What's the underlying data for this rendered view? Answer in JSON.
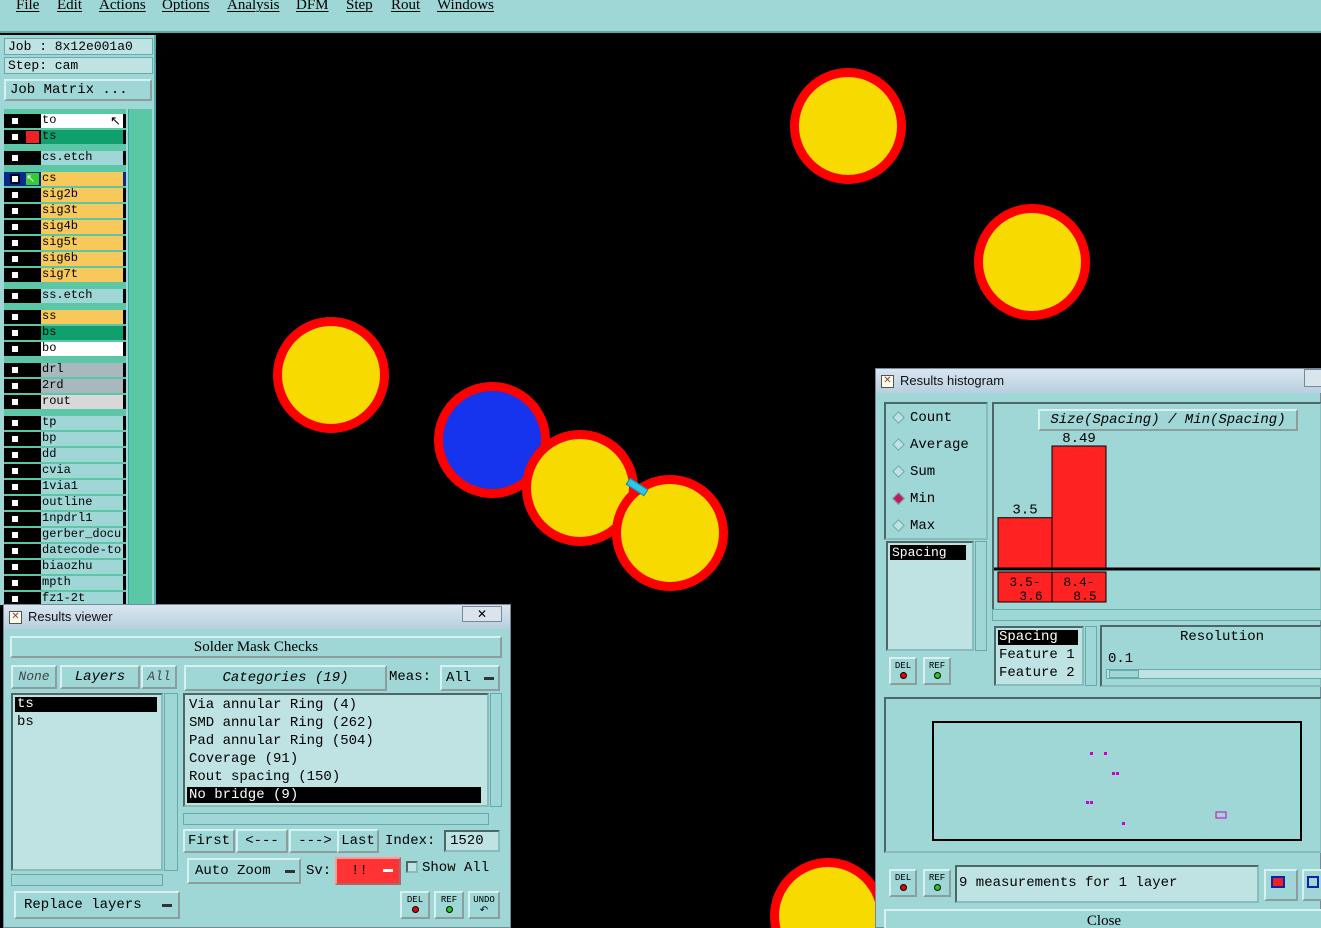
{
  "menu": [
    "File",
    "Edit",
    "Actions",
    "Options",
    "Analysis",
    "DFM",
    "Step",
    "Rout",
    "Windows"
  ],
  "job": {
    "job_line": "Job : 8x12e001a0",
    "step_line": "Step: cam",
    "matrix_button": "Job Matrix ..."
  },
  "layers": [
    {
      "name": "to",
      "bg": "#ffffff",
      "mark": "cursor"
    },
    {
      "name": "ts",
      "bg": "#0fa06e",
      "mark": "red"
    },
    {
      "name": "cs.etch",
      "bg": "#9fd6d6",
      "mark": ""
    },
    {
      "name": "cs",
      "bg": "#f7c95a",
      "mark": "green"
    },
    {
      "name": "sig2b",
      "bg": "#f7c95a",
      "mark": ""
    },
    {
      "name": "sig3t",
      "bg": "#f7c95a",
      "mark": ""
    },
    {
      "name": "sig4b",
      "bg": "#f7c95a",
      "mark": ""
    },
    {
      "name": "sig5t",
      "bg": "#f7c95a",
      "mark": ""
    },
    {
      "name": "sig6b",
      "bg": "#f7c95a",
      "mark": ""
    },
    {
      "name": "sig7t",
      "bg": "#f7c95a",
      "mark": ""
    },
    {
      "name": "ss.etch",
      "bg": "#9fd6d6",
      "mark": ""
    },
    {
      "name": "ss",
      "bg": "#f7c95a",
      "mark": ""
    },
    {
      "name": "bs",
      "bg": "#0fa06e",
      "mark": ""
    },
    {
      "name": "bo",
      "bg": "#ffffff",
      "mark": ""
    },
    {
      "name": "drl",
      "bg": "#a8b8bc",
      "mark": ""
    },
    {
      "name": "2rd",
      "bg": "#a8b8bc",
      "mark": ""
    },
    {
      "name": "rout",
      "bg": "#d8d8d8",
      "mark": ""
    },
    {
      "name": "tp",
      "bg": "#9fd6d6",
      "mark": ""
    },
    {
      "name": "bp",
      "bg": "#9fd6d6",
      "mark": ""
    },
    {
      "name": "dd",
      "bg": "#9fd6d6",
      "mark": ""
    },
    {
      "name": "cvia",
      "bg": "#9fd6d6",
      "mark": ""
    },
    {
      "name": "1via1",
      "bg": "#9fd6d6",
      "mark": ""
    },
    {
      "name": "outline",
      "bg": "#9fd6d6",
      "mark": ""
    },
    {
      "name": "1npdrl1",
      "bg": "#9fd6d6",
      "mark": ""
    },
    {
      "name": "gerber_docu",
      "bg": "#9fd6d6",
      "mark": ""
    },
    {
      "name": "datecode-to",
      "bg": "#9fd6d6",
      "mark": ""
    },
    {
      "name": "biaozhu",
      "bg": "#9fd6d6",
      "mark": ""
    },
    {
      "name": "mpth",
      "bg": "#9fd6d6",
      "mark": ""
    },
    {
      "name": "fz1-2t",
      "bg": "#9fd6d6",
      "mark": ""
    }
  ],
  "results_viewer": {
    "title": "Results viewer",
    "header": "Solder Mask Checks",
    "none_button": "None",
    "layers_button": "Layers",
    "all_button": "All",
    "layers": [
      "ts",
      "bs"
    ],
    "categories_button": "Categories (19)",
    "meas_label": "Meas:",
    "meas_value": "All",
    "categories": [
      "Via annular Ring (4)",
      "SMD annular Ring (262)",
      "Pad annular Ring (504)",
      "Coverage (91)",
      "Rout spacing (150)",
      "No bridge (9)"
    ],
    "selected_category": 5,
    "first_button": "First",
    "prev_button": "<---",
    "next_button": "--->",
    "last_button": "Last",
    "index_label": "Index:",
    "index_value": "1520",
    "auto_zoom": "Auto Zoom",
    "sv_label": "Sv:",
    "sv_value": "!!",
    "show_all": "Show All",
    "replace_layers": "Replace layers",
    "del_label": "DEL",
    "ref_label": "REF",
    "undo_label": "UNDO"
  },
  "histogram": {
    "title": "Results histogram",
    "options": [
      "Count",
      "Average",
      "Sum",
      "Min",
      "Max"
    ],
    "selected_option": "Min",
    "list_item": "Spacing",
    "chart_title": "Size(Spacing) / Min(Spacing)",
    "bars": [
      {
        "label": "3.5",
        "value": 3.5,
        "range": "3.5-\n3.6"
      },
      {
        "label": "8.49",
        "value": 8.49,
        "range": "8.4-\n8.5"
      }
    ],
    "lower_list": [
      "Spacing",
      "Feature 1",
      "Feature 2"
    ],
    "resolution_label": "Resolution",
    "resolution_value": "0.1",
    "measurements_text": "9 measurements for 1 layer",
    "close_button": "Close",
    "del_label": "DEL",
    "ref_label": "REF"
  }
}
